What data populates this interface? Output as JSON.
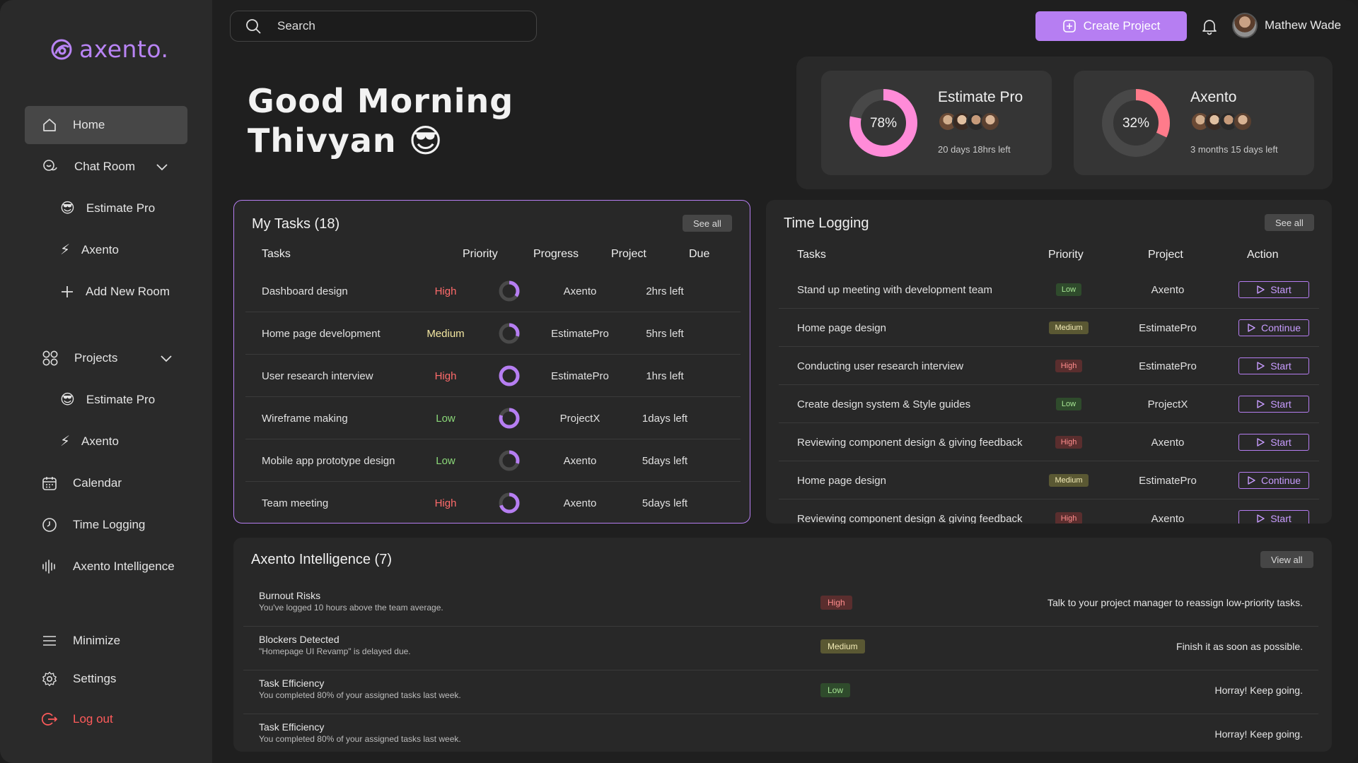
{
  "brand": {
    "name": "axento.",
    "color": "#b984f5"
  },
  "sidebar": {
    "home": "Home",
    "chat_room": "Chat Room",
    "chat_sub": [
      {
        "emoji": "😎",
        "label": "Estimate Pro"
      },
      {
        "emoji": "⚡",
        "label": "Axento"
      }
    ],
    "add_room": "Add New Room",
    "projects": "Projects",
    "project_sub": [
      {
        "emoji": "😎",
        "label": "Estimate Pro"
      },
      {
        "emoji": "⚡",
        "label": "Axento"
      }
    ],
    "calendar": "Calendar",
    "time_logging": "Time Logging",
    "intelligence": "Axento Intelligence",
    "minimize": "Minimize",
    "settings": "Settings",
    "logout": "Log out"
  },
  "search": {
    "placeholder": "Search"
  },
  "header": {
    "create_label": "Create Project",
    "user_name": "Mathew Wade"
  },
  "greeting": {
    "line1": "Good Morning",
    "line2": "Thivyan",
    "emoji": "😎"
  },
  "projects": [
    {
      "name": "Estimate Pro",
      "percent": 78,
      "percent_label": "78%",
      "time_left": "20 days 18hrs left",
      "color": "#ff8bd8"
    },
    {
      "name": "Axento",
      "percent": 32,
      "percent_label": "32%",
      "time_left": "3 months 15 days left",
      "color": "#ff7b8b"
    }
  ],
  "my_tasks": {
    "title": "My Tasks (18)",
    "see_all": "See all",
    "columns": [
      "Tasks",
      "Priority",
      "Progress",
      "Project",
      "Due"
    ],
    "rows": [
      {
        "task": "Dashboard design",
        "priority": "High",
        "progress": 0.35,
        "project": "Axento",
        "due": "2hrs left"
      },
      {
        "task": "Home page development",
        "priority": "Medium",
        "progress": 0.3,
        "project": "EstimatePro",
        "due": "5hrs left"
      },
      {
        "task": "User research interview",
        "priority": "High",
        "progress": 1.0,
        "project": "EstimatePro",
        "due": "1hrs left"
      },
      {
        "task": "Wireframe making",
        "priority": "Low",
        "progress": 0.8,
        "project": "ProjectX",
        "due": "1days left"
      },
      {
        "task": "Mobile app prototype design",
        "priority": "Low",
        "progress": 0.3,
        "project": "Axento",
        "due": "5days left"
      },
      {
        "task": "Team meeting",
        "priority": "High",
        "progress": 0.7,
        "project": "Axento",
        "due": "5days left"
      }
    ]
  },
  "time_logging": {
    "title": "Time Logging",
    "see_all": "See all",
    "columns": [
      "Tasks",
      "Priority",
      "Project",
      "Action"
    ],
    "rows": [
      {
        "task": "Stand up meeting with development team",
        "priority": "Low",
        "project": "Axento",
        "action": "Start"
      },
      {
        "task": "Home page design",
        "priority": "Medium",
        "project": "EstimatePro",
        "action": "Continue"
      },
      {
        "task": "Conducting user research interview",
        "priority": "High",
        "project": "EstimatePro",
        "action": "Start"
      },
      {
        "task": "Create design system & Style guides",
        "priority": "Low",
        "project": "ProjectX",
        "action": "Start"
      },
      {
        "task": "Reviewing component design & giving feedback",
        "priority": "High",
        "project": "Axento",
        "action": "Start"
      },
      {
        "task": "Home page design",
        "priority": "Medium",
        "project": "EstimatePro",
        "action": "Continue"
      },
      {
        "task": "Reviewing component design & giving feedback",
        "priority": "High",
        "project": "Axento",
        "action": "Start"
      }
    ]
  },
  "intelligence": {
    "title": "Axento Intelligence (7)",
    "view_all": "View all",
    "rows": [
      {
        "title": "Burnout Risks",
        "subtitle": "You've logged 10 hours above the team average.",
        "priority": "High",
        "message": "Talk to your project manager to reassign low-priority tasks."
      },
      {
        "title": "Blockers Detected",
        "subtitle": "\"Homepage UI Revamp\" is delayed due.",
        "priority": "Medium",
        "message": "Finish it as soon as possible."
      },
      {
        "title": "Task Efficiency",
        "subtitle": "You completed 80% of your assigned tasks last week.",
        "priority": "Low",
        "message": "Horray! Keep going."
      },
      {
        "title": "Task Efficiency",
        "subtitle": "You completed 80% of your assigned tasks last week.",
        "priority": "",
        "message": "Horray! Keep going."
      }
    ]
  }
}
